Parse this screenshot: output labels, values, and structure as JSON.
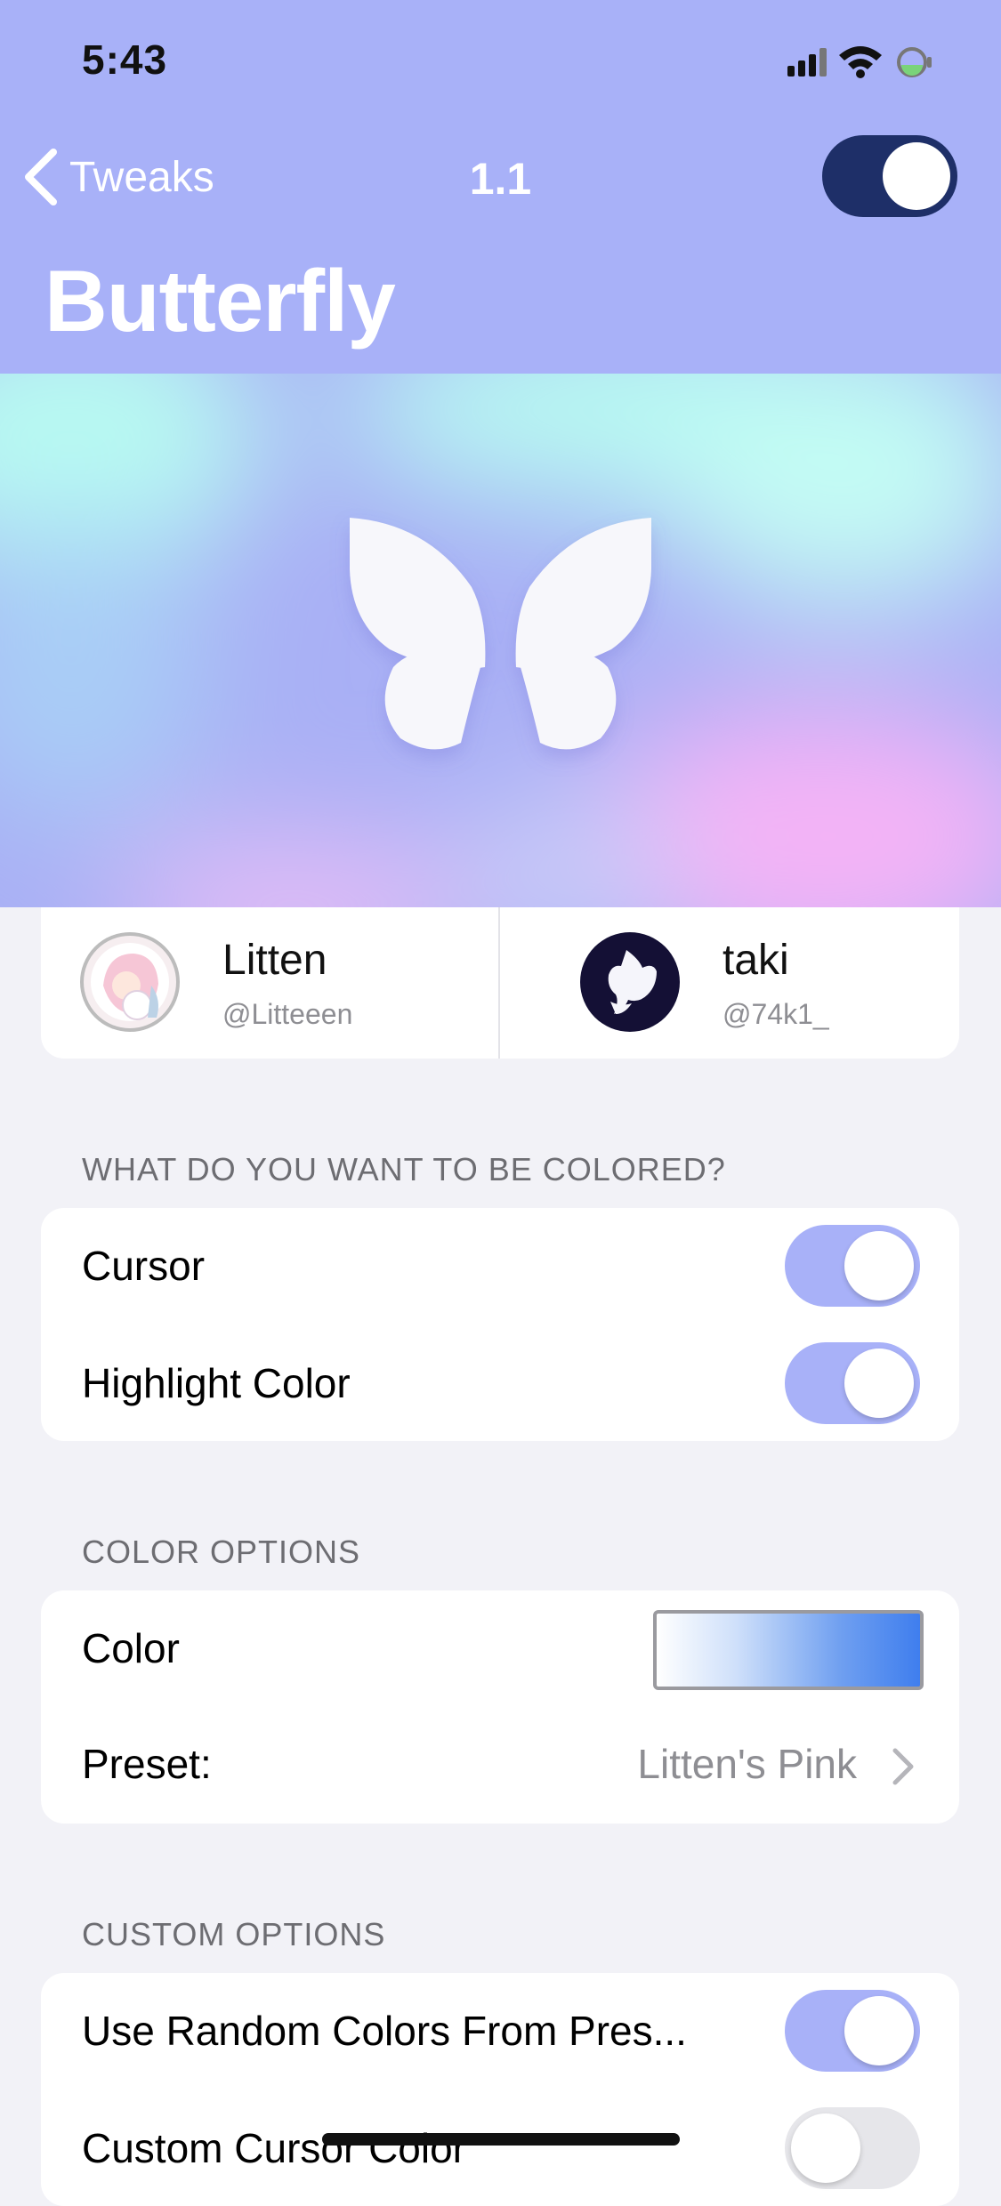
{
  "status_bar": {
    "time": "5:43"
  },
  "nav": {
    "back_label": "Tweaks",
    "title": "1.1",
    "enabled": true
  },
  "header": {
    "title": "Butterfly"
  },
  "credits": [
    {
      "name": "Litten",
      "handle": "@Litteeen"
    },
    {
      "name": "taki",
      "handle": "@74k1_"
    }
  ],
  "sections": {
    "colored": {
      "header": "WHAT DO YOU WANT TO BE COLORED?",
      "rows": [
        {
          "label": "Cursor",
          "on": true
        },
        {
          "label": "Highlight Color",
          "on": true
        }
      ]
    },
    "color_options": {
      "header": "COLOR OPTIONS",
      "color_label": "Color",
      "preset_label": "Preset:",
      "preset_value": "Litten's Pink"
    },
    "custom_options": {
      "header": "CUSTOM OPTIONS",
      "rows": [
        {
          "label": "Use Random Colors From Pres...",
          "on": true
        },
        {
          "label": "Custom Cursor Color",
          "on": false
        }
      ]
    }
  },
  "colors": {
    "accent": "#a8b1f8",
    "nav_toggle": "#1e2f68",
    "background": "#f2f2f7"
  }
}
